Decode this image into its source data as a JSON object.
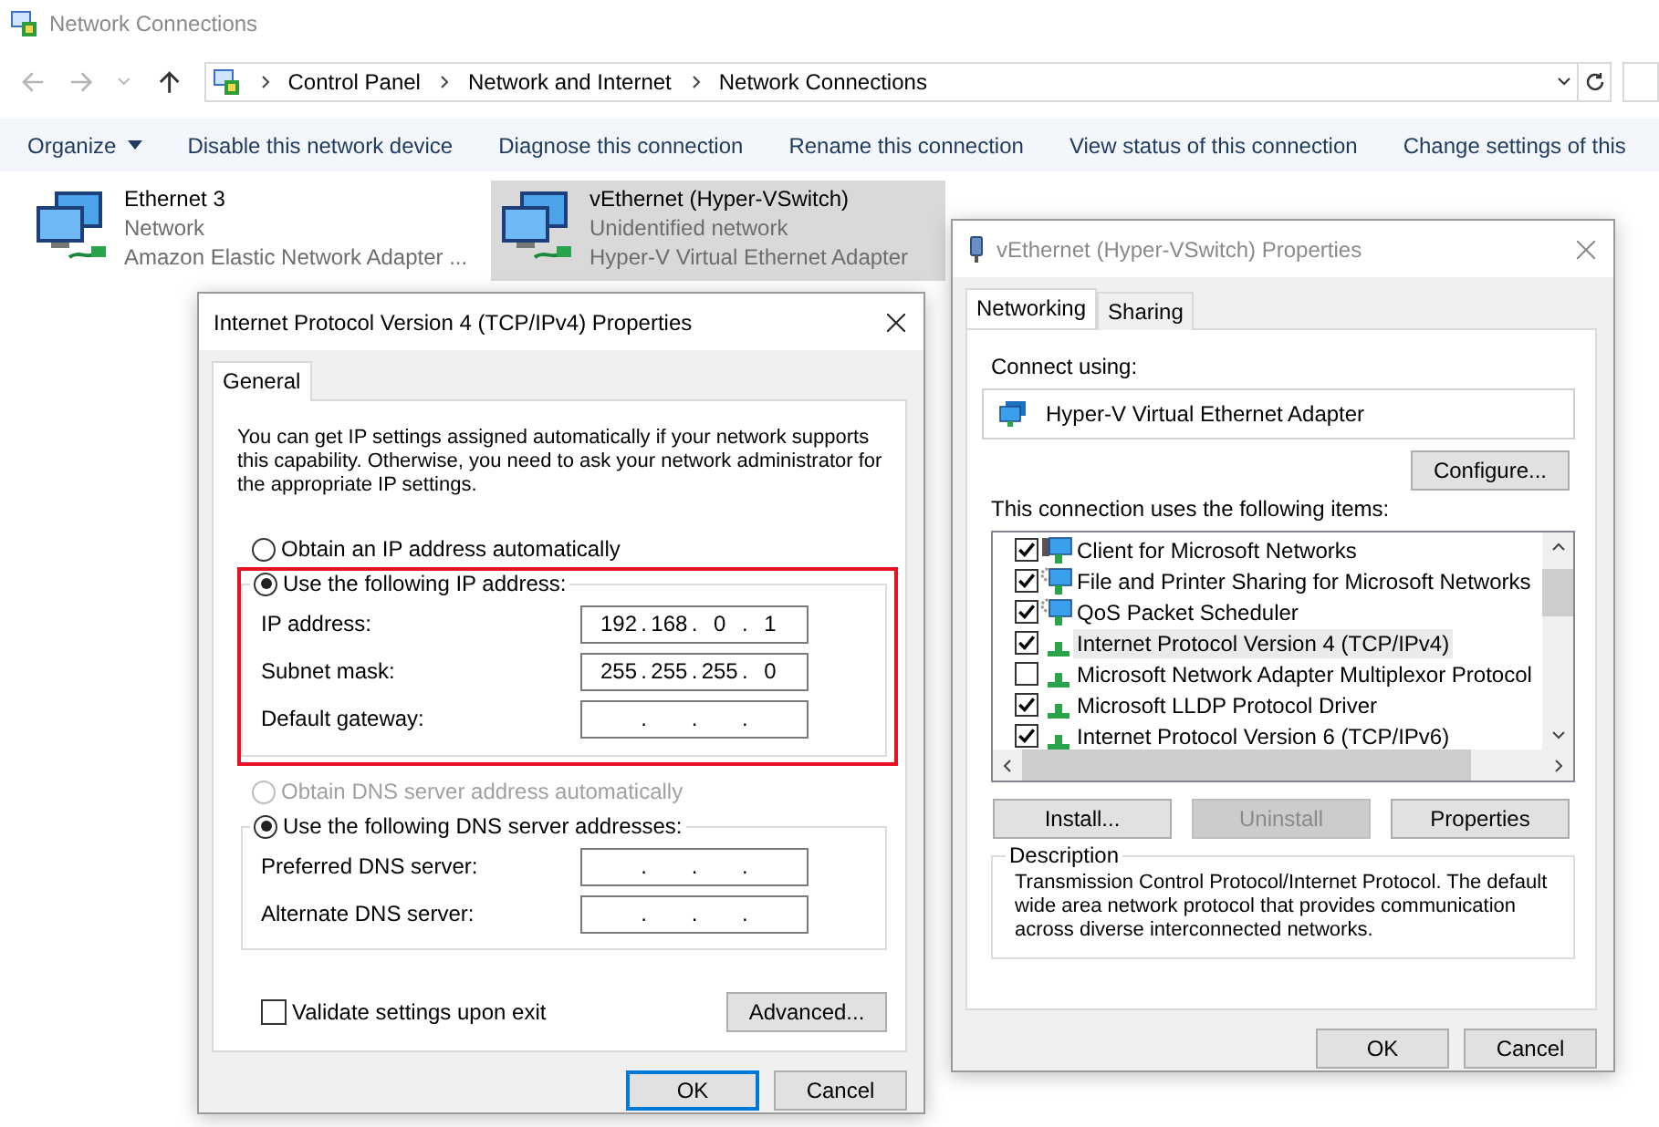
{
  "window": {
    "title": "Network Connections"
  },
  "address_bar": {
    "path": [
      "Control Panel",
      "Network and Internet",
      "Network Connections"
    ]
  },
  "toolbar": [
    {
      "label": "Organize",
      "dropdown": true
    },
    {
      "label": "Disable this network device",
      "dropdown": false
    },
    {
      "label": "Diagnose this connection",
      "dropdown": false
    },
    {
      "label": "Rename this connection",
      "dropdown": false
    },
    {
      "label": "View status of this connection",
      "dropdown": false
    },
    {
      "label": "Change settings of this",
      "dropdown": false
    }
  ],
  "connections": [
    {
      "name": "Ethernet 3",
      "status": "Network",
      "adapter": "Amazon Elastic Network Adapter ...",
      "selected": false
    },
    {
      "name": "vEthernet (Hyper-VSwitch)",
      "status": "Unidentified network",
      "adapter": "Hyper-V Virtual Ethernet Adapter",
      "selected": true
    }
  ],
  "ipv4_dialog": {
    "title": "Internet Protocol Version 4 (TCP/IPv4) Properties",
    "tabs": [
      {
        "label": "General",
        "selected": true
      }
    ],
    "intro": "You can get IP settings assigned automatically if your network supports this capability. Otherwise, you need to ask your network administrator for the appropriate IP settings.",
    "separator": ".",
    "ip_auto": {
      "label": "Obtain an IP address automatically",
      "selected": false,
      "disabled": false
    },
    "ip_manual": {
      "label": "Use the following IP address:",
      "selected": true,
      "disabled": false,
      "highlighted": true
    },
    "ip_fields": [
      {
        "label": "IP address:",
        "octets": [
          "192",
          "168",
          "0",
          "1"
        ]
      },
      {
        "label": "Subnet mask:",
        "octets": [
          "255",
          "255",
          "255",
          "0"
        ]
      },
      {
        "label": "Default gateway:"
      }
    ],
    "dns_auto": {
      "label": "Obtain DNS server address automatically",
      "selected": false,
      "disabled": true
    },
    "dns_manual": {
      "label": "Use the following DNS server addresses:",
      "selected": true,
      "disabled": false,
      "highlighted": false
    },
    "dns_fields": [
      {
        "label": "Preferred DNS server:"
      },
      {
        "label": "Alternate DNS server:"
      }
    ],
    "validate": {
      "label": "Validate settings upon exit",
      "checked": false
    },
    "advanced_button": "Advanced...",
    "buttons": [
      {
        "label": "OK",
        "default": true
      },
      {
        "label": "Cancel",
        "default": false
      }
    ]
  },
  "properties_dialog": {
    "title": "vEthernet (Hyper-VSwitch) Properties",
    "tabs": [
      {
        "label": "Networking",
        "selected": true
      },
      {
        "label": "Sharing",
        "selected": false
      }
    ],
    "connect_using_label": "Connect using:",
    "adapter": "Hyper-V Virtual Ethernet Adapter",
    "configure_button": "Configure...",
    "items_label": "This connection uses the following items:",
    "items": [
      {
        "label": "Client for Microsoft Networks",
        "checked": true,
        "selected": false,
        "kind": "client"
      },
      {
        "label": "File and Printer Sharing for Microsoft Networks",
        "checked": true,
        "selected": false,
        "kind": "service"
      },
      {
        "label": "QoS Packet Scheduler",
        "checked": true,
        "selected": false,
        "kind": "service"
      },
      {
        "label": "Internet Protocol Version 4 (TCP/IPv4)",
        "checked": true,
        "selected": true,
        "kind": "protocol"
      },
      {
        "label": "Microsoft Network Adapter Multiplexor Protocol",
        "checked": false,
        "selected": false,
        "kind": "protocol"
      },
      {
        "label": "Microsoft LLDP Protocol Driver",
        "checked": true,
        "selected": false,
        "kind": "protocol"
      },
      {
        "label": "Internet Protocol Version 6 (TCP/IPv6)",
        "checked": true,
        "selected": false,
        "kind": "protocol"
      }
    ],
    "actions": [
      {
        "label": "Install...",
        "disabled": false
      },
      {
        "label": "Uninstall",
        "disabled": true
      },
      {
        "label": "Properties",
        "disabled": false
      }
    ],
    "description": {
      "legend": "Description",
      "text": "Transmission Control Protocol/Internet Protocol. The default wide area network protocol that provides communication across diverse interconnected networks."
    },
    "buttons": [
      {
        "label": "OK",
        "default": false
      },
      {
        "label": "Cancel",
        "default": false
      }
    ]
  }
}
